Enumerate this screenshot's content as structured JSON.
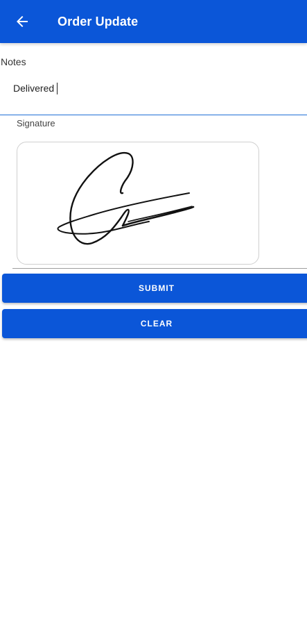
{
  "header": {
    "title": "Order Update",
    "back_icon": "arrow-left-icon",
    "background_color": "#0b56d8"
  },
  "form": {
    "notes_label": "Notes",
    "notes_value": "Delivered",
    "signature_label": "Signature",
    "signature_image": "handwritten-signature"
  },
  "actions": {
    "submit_label": "SUBMIT",
    "clear_label": "CLEAR",
    "button_color": "#0b56d8"
  }
}
